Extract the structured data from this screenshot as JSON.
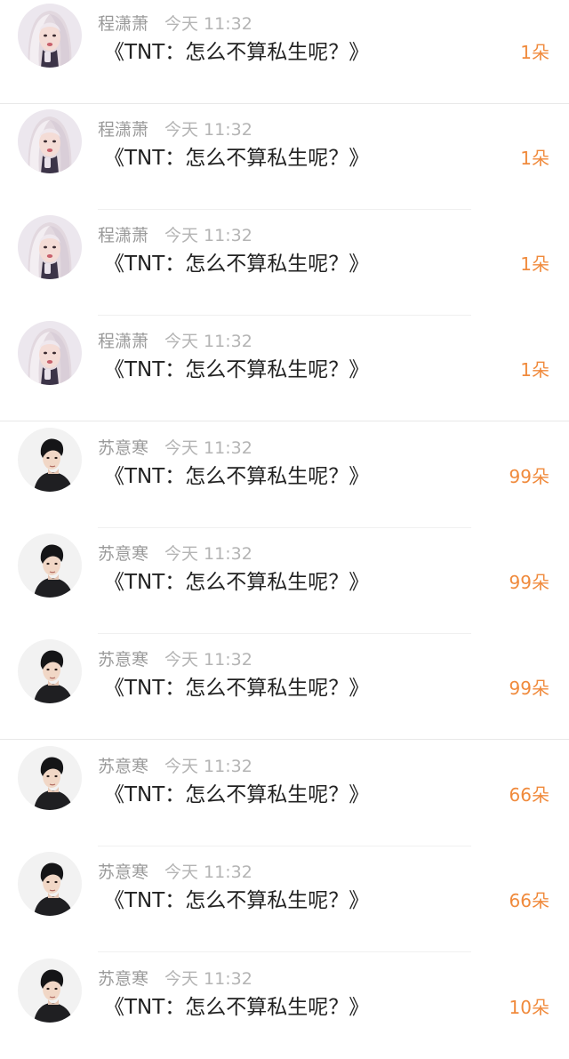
{
  "items": [
    {
      "user": "程潇萧",
      "time": "今天 11:32",
      "title": "《TNT：怎么不算私生呢？》",
      "count": "1朵",
      "avatar": "girl-avatar",
      "divider": "full"
    },
    {
      "user": "程潇萧",
      "time": "今天 11:32",
      "title": "《TNT：怎么不算私生呢？》",
      "count": "1朵",
      "avatar": "girl-avatar",
      "divider": "inset"
    },
    {
      "user": "程潇萧",
      "time": "今天 11:32",
      "title": "《TNT：怎么不算私生呢？》",
      "count": "1朵",
      "avatar": "girl-avatar",
      "divider": "inset"
    },
    {
      "user": "程潇萧",
      "time": "今天 11:32",
      "title": "《TNT：怎么不算私生呢？》",
      "count": "1朵",
      "avatar": "girl-avatar",
      "divider": "full"
    },
    {
      "user": "苏意寒",
      "time": "今天 11:32",
      "title": "《TNT：怎么不算私生呢？》",
      "count": "99朵",
      "avatar": "boy-avatar",
      "divider": "inset"
    },
    {
      "user": "苏意寒",
      "time": "今天 11:32",
      "title": "《TNT：怎么不算私生呢？》",
      "count": "99朵",
      "avatar": "boy-avatar",
      "divider": "inset"
    },
    {
      "user": "苏意寒",
      "time": "今天 11:32",
      "title": "《TNT：怎么不算私生呢？》",
      "count": "99朵",
      "avatar": "boy-avatar",
      "divider": "full"
    },
    {
      "user": "苏意寒",
      "time": "今天 11:32",
      "title": "《TNT：怎么不算私生呢？》",
      "count": "66朵",
      "avatar": "boy-avatar",
      "divider": "inset"
    },
    {
      "user": "苏意寒",
      "time": "今天 11:32",
      "title": "《TNT：怎么不算私生呢？》",
      "count": "66朵",
      "avatar": "boy-avatar",
      "divider": "inset"
    },
    {
      "user": "苏意寒",
      "time": "今天 11:32",
      "title": "《TNT：怎么不算私生呢？》",
      "count": "10朵",
      "avatar": "boy-avatar",
      "divider": "none"
    }
  ],
  "colors": {
    "accent": "#f08a3c",
    "title": "#222222",
    "meta": "#9a9a9a"
  }
}
